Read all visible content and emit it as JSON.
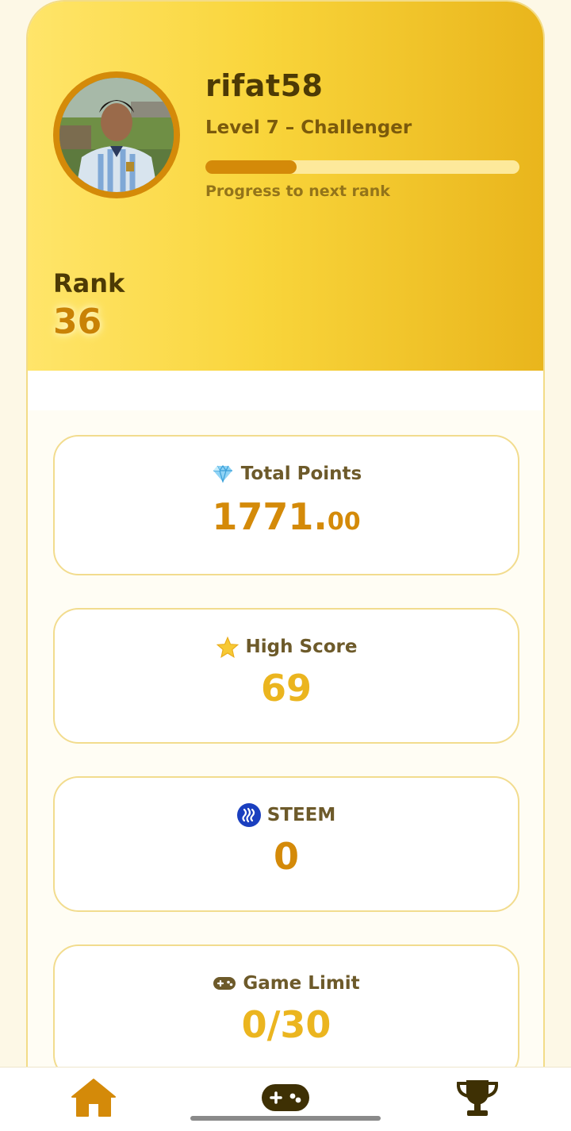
{
  "profile": {
    "username": "rifat58",
    "level": "Level 7 – Challenger",
    "progress_label": "Progress to next rank",
    "progress_fraction": 0.29,
    "avatar_alt": "rifat58"
  },
  "rank": {
    "label": "Rank",
    "value": "36"
  },
  "stats": {
    "total_points": {
      "label": "Total Points",
      "value_int": "1771.",
      "value_dec": "00",
      "icon": "diamond-icon"
    },
    "high_score": {
      "label": "High Score",
      "value": "69",
      "icon": "star-icon"
    },
    "steem": {
      "label": "STEEM",
      "value": "0",
      "icon": "steem-logo-icon"
    },
    "game_limit": {
      "label": "Game Limit",
      "value": "0/30",
      "icon": "gamepad-icon"
    }
  },
  "nav": {
    "items": [
      {
        "name": "home",
        "icon": "home-icon",
        "active": true
      },
      {
        "name": "games",
        "icon": "gamepad-icon"
      },
      {
        "name": "leaderboard",
        "icon": "trophy-icon"
      }
    ]
  },
  "colors": {
    "accent": "#d48a09",
    "header_start": "#ffe56a",
    "header_end": "#e9b51c",
    "dark_text": "#4d3a05",
    "value_orange": "#d48a09",
    "value_yellow": "#ebb51f",
    "card_border": "#f2dc8e"
  }
}
